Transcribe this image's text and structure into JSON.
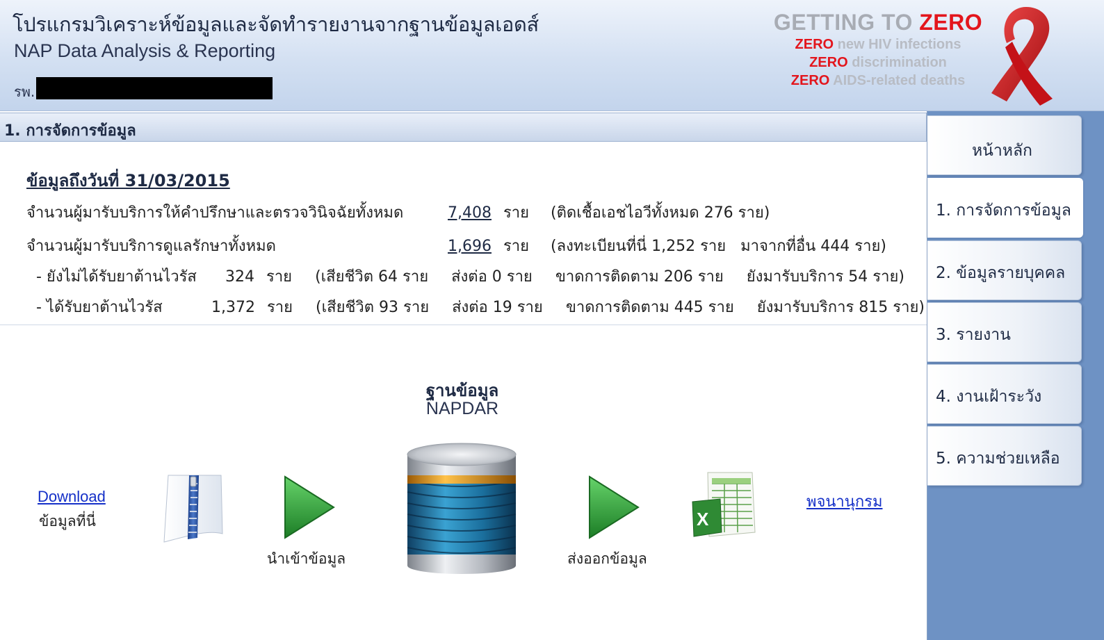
{
  "header": {
    "title_th": "โปรแกรมวิเคราะห์ข้อมูลและจัดทำรายงานจากฐานข้อมูลเอดส์",
    "title_en": "NAP Data Analysis & Reporting",
    "hospital_label": "รพ.",
    "campaign": {
      "head_a": "GETTING TO",
      "head_b": "ZERO",
      "zero_word": "ZERO",
      "line1": "new HIV infections",
      "line2": "discrimination",
      "line3": "AIDS-related deaths"
    },
    "ribbon_icon": "red-ribbon-icon"
  },
  "section_title": "1. การจัดการข้อมูล",
  "stats": {
    "as_of": "ข้อมูลถึงวันที่ 31/03/2015",
    "row1": {
      "label": "จำนวนผู้มารับบริการให้คำปรึกษาและตรวจวินิจฉัยทั้งหมด",
      "value": "7,408",
      "unit": "ราย",
      "detail": "(ติดเชื้อเอชไอวีทั้งหมด 276 ราย)"
    },
    "row2": {
      "label": "จำนวนผู้มารับบริการดูแลรักษาทั้งหมด",
      "value": "1,696",
      "unit": "ราย",
      "detail": "(ลงทะเบียนที่นี่ 1,252 ราย   มาจากที่อื่น 444 ราย)"
    },
    "row3": {
      "label": "- ยังไม่ได้รับยาต้านไวรัส",
      "value": "324",
      "unit": "ราย",
      "d1": "(เสียชีวิต 64 ราย",
      "d2": "ส่งต่อ 0 ราย",
      "d3": "ขาดการติดตาม 206 ราย",
      "d4": "ยังมารับบริการ 54 ราย)"
    },
    "row4": {
      "label": "- ได้รับยาต้านไวรัส",
      "value": "1,372",
      "unit": "ราย",
      "d1": "(เสียชีวิต 93 ราย",
      "d2": "ส่งต่อ 19 ราย",
      "d3": "ขาดการติดตาม 445 ราย",
      "d4": "ยังมารับบริการ 815 ราย)"
    }
  },
  "flow": {
    "download_link": "Download",
    "download_sub": "ข้อมูลที่นี่",
    "import_label": "นำเข้าข้อมูล",
    "db_title_th": "ฐานข้อมูล",
    "db_title_en": "NAPDAR",
    "export_label": "ส่งออกข้อมูล",
    "dictionary_link": "พจนานุกรม",
    "icons": [
      "zip-file-icon",
      "import-arrow-icon",
      "database-icon",
      "export-arrow-icon",
      "excel-file-icon"
    ]
  },
  "nav": {
    "tabs": [
      {
        "label": "หน้าหลัก"
      },
      {
        "label": "1. การจัดการข้อมูล"
      },
      {
        "label": "2. ข้อมูลรายบุคคล"
      },
      {
        "label": "3. รายงาน"
      },
      {
        "label": "4. งานเฝ้าระวัง"
      },
      {
        "label": "5. ความช่วยเหลือ"
      }
    ],
    "active_index": 1
  },
  "colors": {
    "accent_red": "#e3151c",
    "nav_bg": "#6e92c4",
    "header_bg": "#d3e0f2",
    "link": "#1530c8"
  }
}
